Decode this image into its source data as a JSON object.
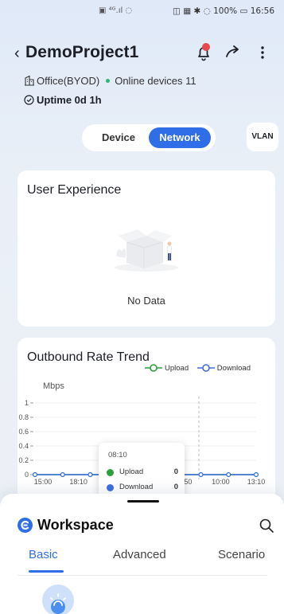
{
  "status_bar": {
    "battery": "100%",
    "time": "16:56"
  },
  "header": {
    "title": "DemoProject1"
  },
  "site": {
    "office": "Office(BYOD)",
    "online_devices": "Online devices 11",
    "uptime": "Uptime 0d 1h"
  },
  "view_toggle": {
    "device_label": "Device",
    "network_label": "Network",
    "selected": "Network",
    "vlan_label": "VLAN"
  },
  "user_experience": {
    "title": "User Experience",
    "empty_text": "No Data"
  },
  "outbound_rate": {
    "title": "Outbound Rate Trend",
    "tooltip": {
      "time": "08:10",
      "upload_label": "Upload",
      "upload_value": "0",
      "download_label": "Download",
      "download_value": "0"
    }
  },
  "chart_data": {
    "type": "line",
    "title": "Outbound Rate Trend",
    "ylabel": "Mbps",
    "ylim": [
      0,
      1
    ],
    "yticks": [
      "1",
      "0.8",
      "0.6",
      "0.4",
      "0.2",
      "0"
    ],
    "xticks": [
      "15:00",
      "18:10",
      "",
      "",
      "5:50",
      "10:00",
      "13:10"
    ],
    "legend_position": "top-right",
    "series": [
      {
        "name": "Upload",
        "color": "#2e9e3e",
        "values": [
          0,
          0,
          0,
          0,
          0,
          0,
          0,
          0,
          0
        ]
      },
      {
        "name": "Download",
        "color": "#3b6fe0",
        "values": [
          0,
          0,
          0,
          0,
          0,
          0,
          0,
          0,
          0
        ]
      }
    ],
    "grid": true
  },
  "workspace": {
    "title": "Workspace",
    "tabs": [
      {
        "label": "Basic"
      },
      {
        "label": "Advanced"
      },
      {
        "label": "Scenario"
      }
    ],
    "selected_tab": "Basic"
  },
  "colors": {
    "accent": "#2f6ee6",
    "online": "#2bb673",
    "alert": "#e5484d"
  }
}
